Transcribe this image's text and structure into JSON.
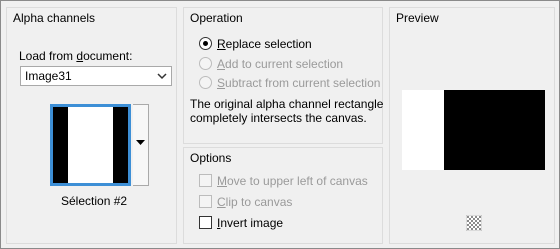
{
  "alpha": {
    "title": "Alpha channels",
    "load_label_pre": "Load from ",
    "load_label_u": "d",
    "load_label_post": "ocument:",
    "document_value": "Image31",
    "selection_name": "Sélection #2"
  },
  "operation": {
    "title": "Operation",
    "replace_u": "R",
    "replace_rest": "eplace selection",
    "add_u": "A",
    "add_rest": "dd to current selection",
    "subtract_u": "S",
    "subtract_rest": "ubtract from current selection",
    "message_line1": "The original alpha channel rectangle",
    "message_line2": "completely intersects the canvas."
  },
  "options": {
    "title": "Options",
    "move_u": "M",
    "move_rest": "ove to upper left of canvas",
    "clip_u": "C",
    "clip_rest": "lip to canvas",
    "invert_u": "I",
    "invert_rest": "nvert image"
  },
  "preview": {
    "title": "Preview",
    "checker_icon": "transparency-checker-icon"
  }
}
